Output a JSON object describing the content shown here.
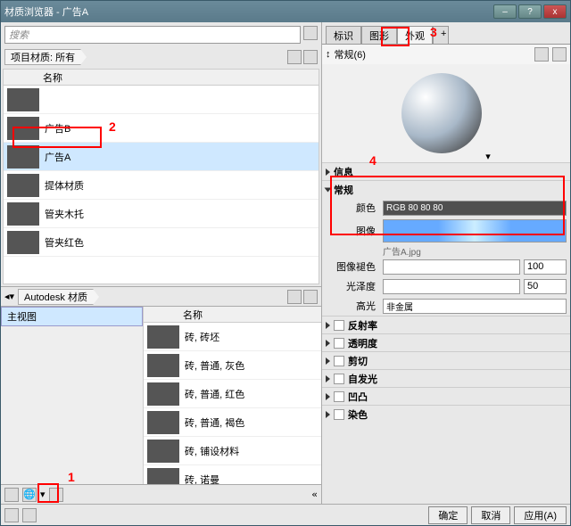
{
  "window_title": "材质浏览器 - 广告A",
  "search_placeholder": "搜索",
  "project_filter_label": "项目材质: 所有",
  "col_name": "名称",
  "project_items": [
    {
      "label": "",
      "sel": false
    },
    {
      "label": "广告B",
      "sel": false
    },
    {
      "label": "广告A",
      "sel": true
    },
    {
      "label": "提体材质",
      "sel": false
    },
    {
      "label": "管夹木托",
      "sel": false
    },
    {
      "label": "管夹红色",
      "sel": false
    }
  ],
  "lib_breadcrumb": "Autodesk 材质",
  "tree_node": "主视图",
  "lib_items": [
    "砖, 砖坯",
    "砖, 普通, 灰色",
    "砖, 普通, 红色",
    "砖, 普通, 褐色",
    "砖, 铺设材料",
    "砖, 诺曼"
  ],
  "collapse": "«",
  "tabs": {
    "id": "标识",
    "gfx": "图形",
    "app": "外观",
    "plus": "+"
  },
  "regular_header": "常规(6)",
  "section_info": "信息",
  "section_cg": "常规",
  "p_color": {
    "label": "颜色",
    "value": "RGB 80 80 80"
  },
  "p_image": {
    "label": "图像",
    "subtext": "广告A.jpg"
  },
  "p_fade": {
    "label": "图像褪色",
    "value": "100"
  },
  "p_gloss": {
    "label": "光泽度",
    "value": "50"
  },
  "p_hilite": {
    "label": "高光",
    "value": "非金属"
  },
  "sections": [
    "反射率",
    "透明度",
    "剪切",
    "自发光",
    "凹凸",
    "染色"
  ],
  "buttons": {
    "ok": "确定",
    "cancel": "取消",
    "apply": "应用(A)"
  }
}
